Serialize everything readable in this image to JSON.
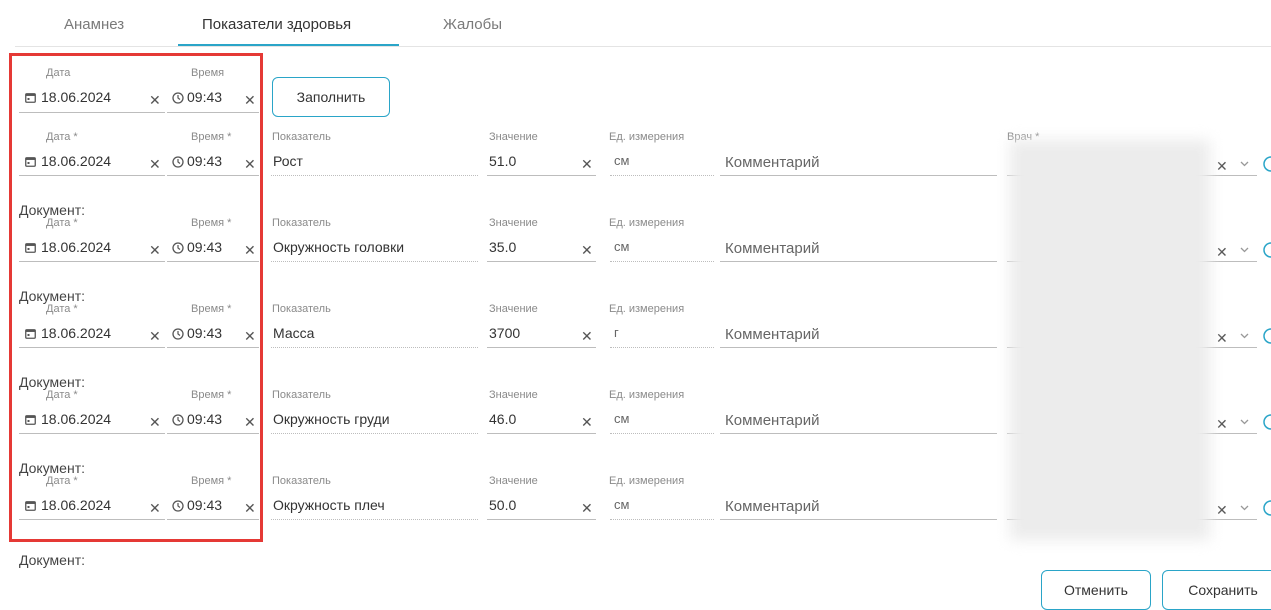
{
  "tabs": [
    {
      "label": "Анамнез",
      "active": false
    },
    {
      "label": "Показатели здоровья",
      "active": true
    },
    {
      "label": "Жалобы",
      "active": false
    }
  ],
  "header_row": {
    "date_label": "Дата",
    "time_label": "Время",
    "date_value": "18.06.2024",
    "time_value": "09:43",
    "fill_button": "Заполнить"
  },
  "field_labels": {
    "date": "Дата *",
    "time": "Время *",
    "indicator": "Показатель",
    "value": "Значение",
    "unit": "Ед. измерения",
    "doctor": "Врач *",
    "comment_placeholder": "Комментарий",
    "document": "Документ:"
  },
  "rows": [
    {
      "date": "18.06.2024",
      "time": "09:43",
      "indicator": "Рост",
      "value": "51.0",
      "unit": "см"
    },
    {
      "date": "18.06.2024",
      "time": "09:43",
      "indicator": "Окружность головки",
      "value": "35.0",
      "unit": "см"
    },
    {
      "date": "18.06.2024",
      "time": "09:43",
      "indicator": "Масса",
      "value": "3700",
      "unit": "г"
    },
    {
      "date": "18.06.2024",
      "time": "09:43",
      "indicator": "Окружность груди",
      "value": "46.0",
      "unit": "см"
    },
    {
      "date": "18.06.2024",
      "time": "09:43",
      "indicator": "Окружность плеч",
      "value": "50.0",
      "unit": "см"
    }
  ],
  "clear_glyph": "✕",
  "footer": {
    "cancel": "Отменить",
    "save": "Сохранить"
  },
  "colors": {
    "accent": "#2aa5c8",
    "highlight": "#e53935"
  }
}
